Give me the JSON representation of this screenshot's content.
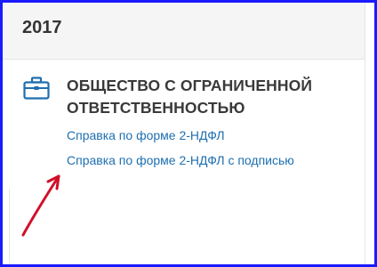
{
  "header": {
    "year": "2017"
  },
  "org": {
    "icon": "briefcase-icon",
    "name": "ОБЩЕСТВО С ОГРАНИЧЕННОЙ ОТВЕТСТВЕННОСТЬЮ"
  },
  "links": [
    {
      "label": "Справка по форме 2-НДФЛ"
    },
    {
      "label": "Справка по форме 2-НДФЛ с подписью"
    }
  ],
  "colors": {
    "frame": "#1a1aff",
    "link": "#1e6fb0",
    "icon": "#1e6fb0",
    "arrow": "#d0102a"
  }
}
